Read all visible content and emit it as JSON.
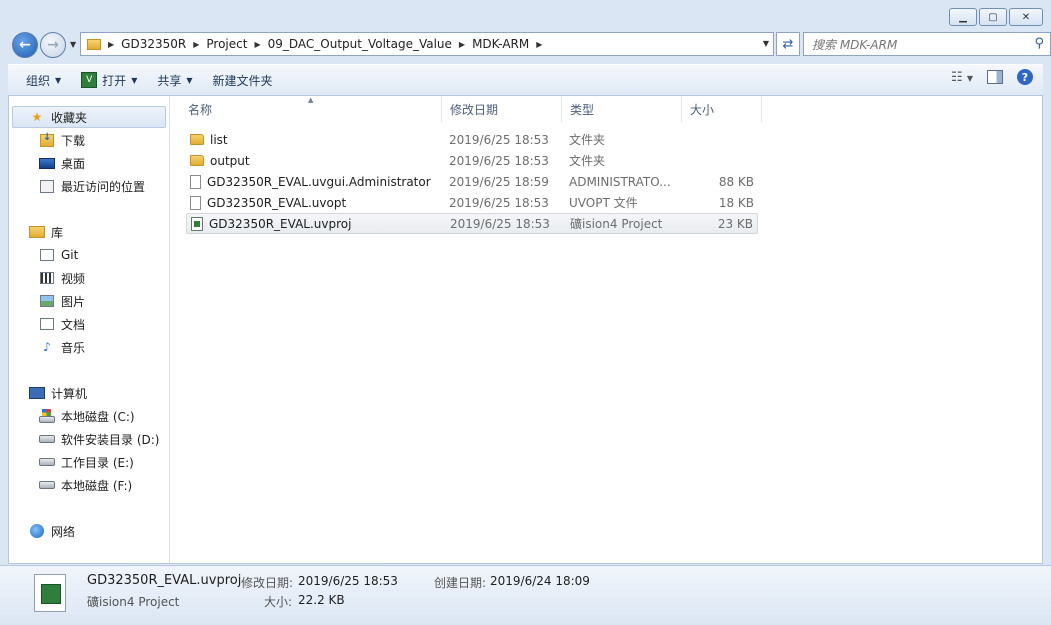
{
  "window": {
    "caption_buttons": [
      "minimize-icon",
      "maximize-icon",
      "close-icon"
    ]
  },
  "address": {
    "crumbs": [
      "GD32350R",
      "Project",
      "09_DAC_Output_Voltage_Value",
      "MDK-ARM"
    ]
  },
  "search": {
    "placeholder": "搜索 MDK-ARM"
  },
  "toolbar": {
    "organize": "组织",
    "open": "打开",
    "share": "共享",
    "new_folder": "新建文件夹"
  },
  "sidebar": {
    "favorites": {
      "label": "收藏夹",
      "items": [
        "下载",
        "桌面",
        "最近访问的位置"
      ]
    },
    "libraries": {
      "label": "库",
      "items": [
        "Git",
        "视频",
        "图片",
        "文档",
        "音乐"
      ]
    },
    "computer": {
      "label": "计算机",
      "items": [
        "本地磁盘 (C:)",
        "软件安装目录 (D:)",
        "工作目录 (E:)",
        "本地磁盘 (F:)"
      ]
    },
    "network": {
      "label": "网络"
    }
  },
  "columns": {
    "name": "名称",
    "date": "修改日期",
    "type": "类型",
    "size": "大小"
  },
  "files": [
    {
      "name": "list",
      "date": "2019/6/25 18:53",
      "type": "文件夹",
      "size": "",
      "icon": "folder-icon"
    },
    {
      "name": "output",
      "date": "2019/6/25 18:53",
      "type": "文件夹",
      "size": "",
      "icon": "folder-icon"
    },
    {
      "name": "GD32350R_EVAL.uvgui.Administrator",
      "date": "2019/6/25 18:59",
      "type": "ADMINISTRATO...",
      "size": "88 KB",
      "icon": "file-icon"
    },
    {
      "name": "GD32350R_EVAL.uvopt",
      "date": "2019/6/25 18:53",
      "type": "UVOPT 文件",
      "size": "18 KB",
      "icon": "file-icon"
    },
    {
      "name": "GD32350R_EVAL.uvproj",
      "date": "2019/6/25 18:53",
      "type": "礦ision4 Project",
      "size": "23 KB",
      "icon": "uvproj-icon",
      "selected": true
    }
  ],
  "details": {
    "filename": "GD32350R_EVAL.uvproj",
    "type": "礦ision4 Project",
    "modified_label": "修改日期:",
    "modified": "2019/6/25 18:53",
    "created_label": "创建日期:",
    "created": "2019/6/24 18:09",
    "size_label": "大小:",
    "size": "22.2 KB"
  }
}
